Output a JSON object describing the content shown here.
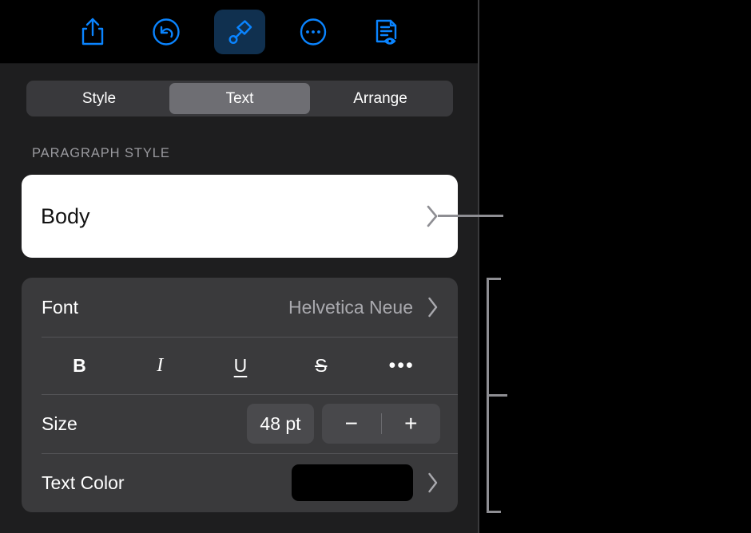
{
  "app": {
    "panel_title": "Format panel"
  },
  "toolbar": {
    "items": [
      {
        "name": "share-icon",
        "label": "Share"
      },
      {
        "name": "undo-icon",
        "label": "Undo"
      },
      {
        "name": "brush-icon",
        "label": "Format",
        "selected": true
      },
      {
        "name": "ellipsis-icon",
        "label": "More"
      },
      {
        "name": "document-view-icon",
        "label": "Document Options"
      }
    ],
    "accent_color": "#0a84ff",
    "selected_background": "#10304f"
  },
  "segmented_control": {
    "options": [
      "Style",
      "Text",
      "Arrange"
    ],
    "selected": "Text",
    "selected_index": 1
  },
  "paragraph_style": {
    "section_label": "PARAGRAPH STYLE",
    "value": "Body",
    "chevron": "chevron-right-icon"
  },
  "font_group": {
    "font_row": {
      "label": "Font",
      "value": "Helvetica Neue",
      "chevron": "chevron-right-icon"
    },
    "format_buttons": [
      {
        "name": "bold-button",
        "glyph": "B"
      },
      {
        "name": "italic-button",
        "glyph": "I"
      },
      {
        "name": "underline-button",
        "glyph": "U"
      },
      {
        "name": "strikethrough-button",
        "glyph": "S"
      },
      {
        "name": "more-text-options-button",
        "glyph": "•••"
      }
    ],
    "size_row": {
      "label": "Size",
      "value": "48 pt",
      "decrement": "−",
      "increment": "+"
    },
    "text_color_row": {
      "label": "Text Color",
      "swatch_color": "#000000",
      "chevron": "chevron-right-icon"
    }
  },
  "annotations": {
    "paragraph_style_callout": "leader line to paragraph style control",
    "font_group_callout": "bracket spanning font controls"
  },
  "colors": {
    "panel_background": "#1e1e1f",
    "card_background": "#3a3a3c",
    "separator": "#545457",
    "segment_track": "#39393c",
    "segment_selected": "#6e6e73",
    "secondary_text": "#a9a9ae",
    "section_label_text": "#9a9a9f",
    "callout": "#8e8e93"
  }
}
